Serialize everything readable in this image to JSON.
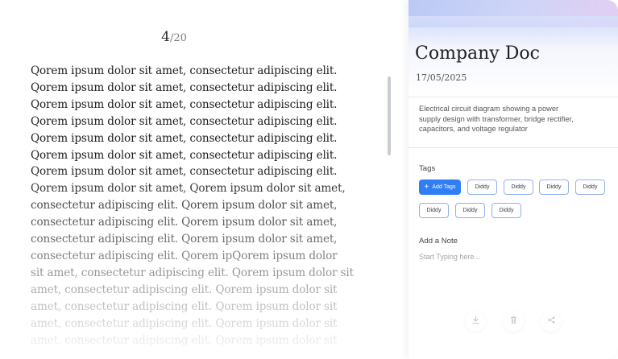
{
  "reader": {
    "page_current": "4",
    "page_separator": "/",
    "page_total": "20",
    "lines": [
      "Qorem ipsum dolor sit amet, consectetur adipiscing elit.",
      "Qorem ipsum dolor sit amet, consectetur adipiscing elit.",
      "Qorem ipsum dolor sit amet, consectetur adipiscing elit.",
      "Qorem ipsum dolor sit amet, consectetur adipiscing elit.",
      "Qorem ipsum dolor sit amet, consectetur adipiscing elit.",
      "Qorem ipsum dolor sit amet, consectetur adipiscing elit.",
      "Qorem ipsum dolor sit amet, consectetur adipiscing elit.",
      "Qorem ipsum dolor sit amet, Qorem ipsum dolor sit amet,",
      "consectetur adipiscing elit. Qorem ipsum dolor sit amet,",
      "consectetur adipiscing elit. Qorem ipsum dolor sit amet,",
      "consectetur adipiscing elit. Qorem ipsum dolor sit amet,",
      "consectetur adipiscing elit. Qorem ipQorem ipsum dolor",
      "sit amet, consectetur adipiscing elit. Qorem ipsum dolor sit",
      "amet, consectetur adipiscing elit. Qorem ipsum dolor sit",
      "amet, consectetur adipiscing elit. Qorem ipsum dolor sit",
      "amet, consectetur adipiscing elit. Qorem ipsum dolor sit",
      "amet, consectetur adipiscing elit. Qorem ipsum dolor sit"
    ]
  },
  "panel": {
    "title": "Company Doc",
    "date": "17/05/2025",
    "description": "Electrical circuit diagram showing a power supply design with transformer, bridge rectifier, capacitors, and voltage regulator",
    "tags_label": "Tags",
    "add_tag_label": "Add Tags",
    "tags": [
      "Diddy",
      "Diddy",
      "Diddy",
      "Diddy",
      "Diddy",
      "Diddy",
      "Diddy"
    ],
    "note_label": "Add a Note",
    "note_placeholder": "Start Typing here...",
    "note_value": "",
    "actions": [
      {
        "icon": "download-icon"
      },
      {
        "icon": "trash-icon"
      },
      {
        "icon": "share-icon"
      }
    ]
  },
  "colors": {
    "accent": "#2f7ef6",
    "tag_border": "#8fb2ee",
    "text": "#1d1d1d"
  }
}
